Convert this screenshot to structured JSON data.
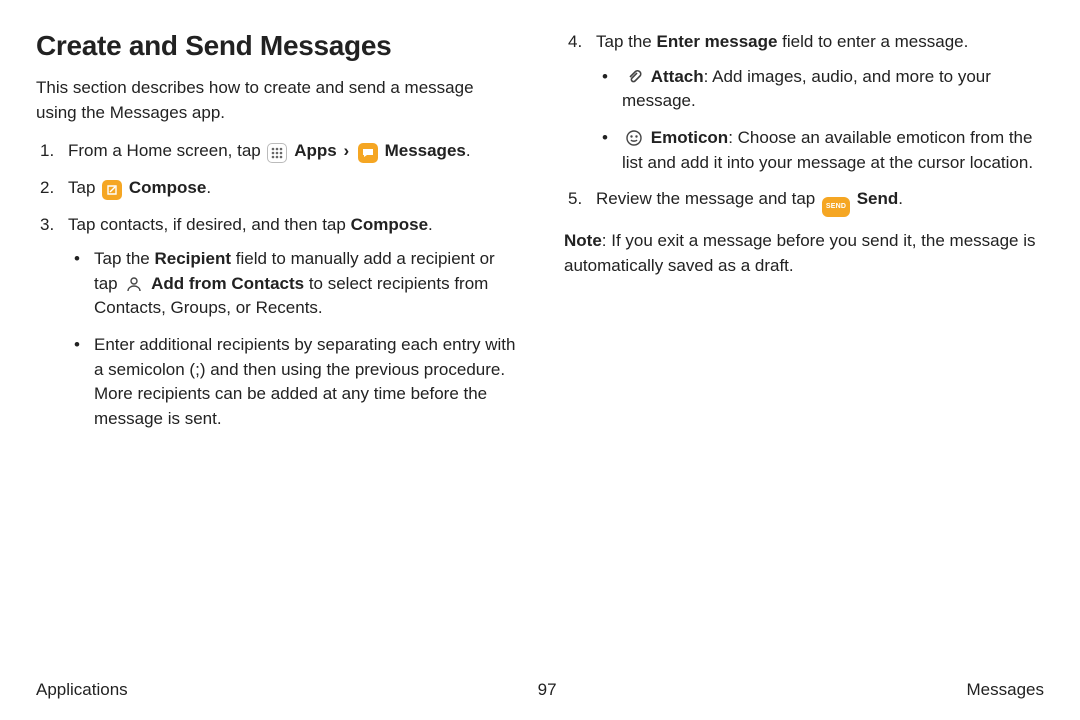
{
  "title": "Create and Send Messages",
  "intro": "This section describes how to create and send a message using the Messages app.",
  "labels": {
    "apps": "Apps",
    "messages": "Messages",
    "compose": "Compose",
    "compose2": "Compose",
    "recipient": "Recipient",
    "add_from_contacts": "Add from Contacts",
    "enter_message": "Enter message",
    "attach": "Attach",
    "emoticon": "Emoticon",
    "send": "Send",
    "note": "Note"
  },
  "step1_a": "From a Home screen, tap ",
  "step1_b": ".",
  "step2_a": "Tap ",
  "step2_b": ".",
  "step3_a": "Tap contacts, if desired, and then tap ",
  "step3_b": ".",
  "step3_bullet1_a": "Tap the ",
  "step3_bullet1_b": " field to manually add a recipient or tap ",
  "step3_bullet1_c": " to select recipients from Contacts, Groups, or Recents.",
  "step3_bullet2": "Enter additional recipients by separating each entry with a semicolon (;) and then using the previous procedure. More recipients can be added at any time before the message is sent.",
  "step4_a": "Tap the ",
  "step4_b": " field to enter a message.",
  "step4_bullet1_b": ": Add images, audio, and more to your message.",
  "step4_bullet2_b": ": Choose an available emoticon from the list and add it into your message at the cursor location.",
  "step5_a": "Review the message and tap ",
  "step5_b": ".",
  "note_text": ": If you exit a message before you send it, the message is automatically saved as a draft.",
  "footer": {
    "left": "Applications",
    "center": "97",
    "right": "Messages"
  },
  "send_badge": "SEND",
  "chevron": "›"
}
